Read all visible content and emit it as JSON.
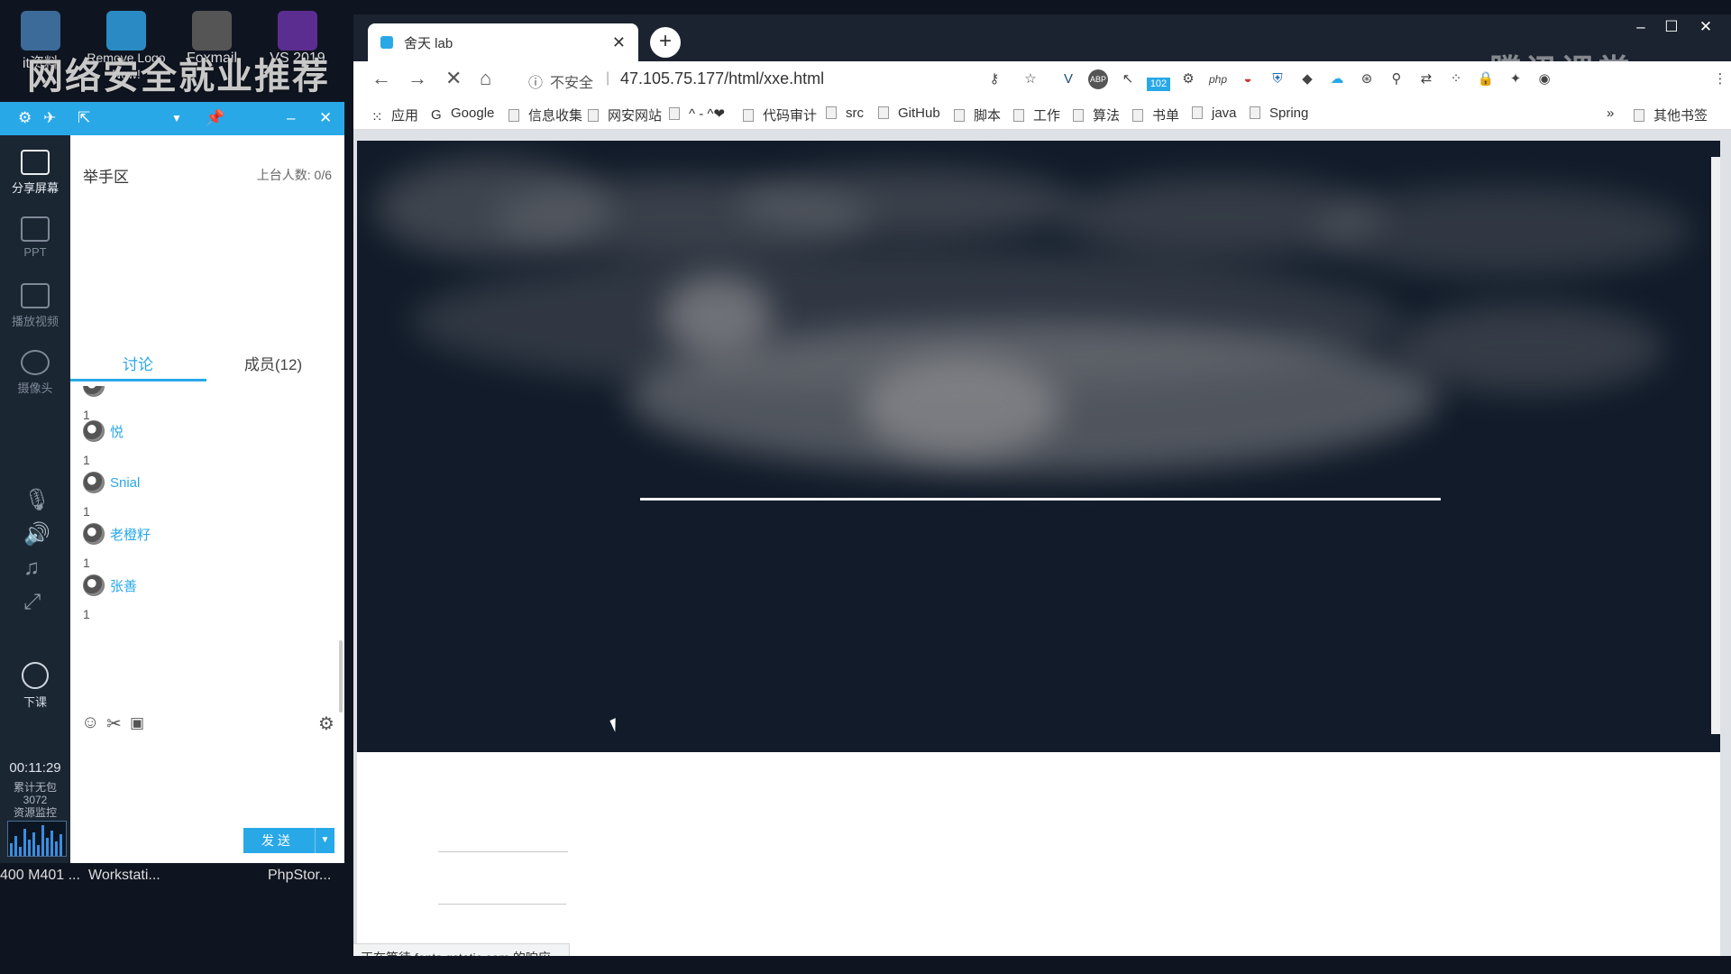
{
  "desktop": {
    "watermark": "网络安全就业推荐",
    "icons": [
      {
        "label": "it资料"
      },
      {
        "label": "Remove Logo Now!"
      },
      {
        "label": "Foxmail"
      },
      {
        "label": "VS 2019"
      }
    ],
    "taskbar": [
      {
        "label": "400 M401 ..."
      },
      {
        "label": "Workstati..."
      },
      {
        "label": "PhpStor..."
      }
    ]
  },
  "classroom": {
    "rail": [
      {
        "label": "分享屏幕",
        "icon": "share-screen-icon"
      },
      {
        "label": "PPT",
        "icon": "ppt-icon"
      },
      {
        "label": "播放视频",
        "icon": "video-icon"
      },
      {
        "label": "摄像头",
        "icon": "camera-icon"
      }
    ],
    "end_class": "下课",
    "timer": "00:11:29",
    "stat_line1": "累计无包",
    "stat_line2": "3072",
    "stat_line3": "资源监控",
    "hand_raise_title": "举手区",
    "on_stage": "上台人数: 0/6",
    "tabs": {
      "discuss": "讨论",
      "members": "成员(12)"
    },
    "messages": [
      {
        "name": "",
        "text": "1"
      },
      {
        "name": "悦",
        "text": "1"
      },
      {
        "name": "Snial",
        "text": "1"
      },
      {
        "name": "老橙籽",
        "text": "1"
      },
      {
        "name": "张善",
        "text": "1"
      }
    ],
    "send": "发 送"
  },
  "browser": {
    "tab_title": "舍天 lab",
    "insecure": "不安全",
    "url": "47.105.75.177/html/xxe.html",
    "ext_badge": "102",
    "brand_watermark": "腾讯课堂",
    "bookmarks": [
      {
        "label": "应用",
        "icon": "apps-icon"
      },
      {
        "label": "Google",
        "icon": "google-icon"
      },
      {
        "label": "信息收集",
        "icon": "folder-icon"
      },
      {
        "label": "网安网站",
        "icon": "folder-icon"
      },
      {
        "label": "^ - ^❤",
        "icon": "folder-icon"
      },
      {
        "label": "代码审计",
        "icon": "folder-icon"
      },
      {
        "label": "src",
        "icon": "folder-icon"
      },
      {
        "label": "GitHub",
        "icon": "folder-icon"
      },
      {
        "label": "脚本",
        "icon": "folder-icon"
      },
      {
        "label": "工作",
        "icon": "folder-icon"
      },
      {
        "label": "算法",
        "icon": "folder-icon"
      },
      {
        "label": "书单",
        "icon": "folder-icon"
      },
      {
        "label": "java",
        "icon": "folder-icon"
      },
      {
        "label": "Spring",
        "icon": "folder-icon"
      }
    ],
    "more_bookmarks": "»",
    "other_bookmarks": "其他书签",
    "status": "正在等待 fonts.gstatic.com 的响应..."
  },
  "colors": {
    "accent": "#29a8e8",
    "hero_bg": "#111b29",
    "rail_bg": "#1b2633"
  }
}
